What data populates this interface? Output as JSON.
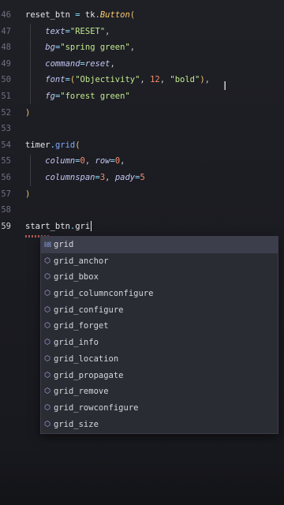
{
  "editor": {
    "lines": [
      {
        "num": "46",
        "parts": [
          {
            "t": "reset_btn",
            "c": "var"
          },
          {
            "t": " = ",
            "c": "op"
          },
          {
            "t": "tk",
            "c": "var"
          },
          {
            "t": ".",
            "c": "op"
          },
          {
            "t": "Button",
            "c": "cls"
          },
          {
            "t": "(",
            "c": "par"
          }
        ]
      },
      {
        "num": "47",
        "parts": [
          {
            "t": "    text",
            "c": "kw"
          },
          {
            "t": "=",
            "c": "op"
          },
          {
            "t": "\"RESET\"",
            "c": "str"
          },
          {
            "t": ",",
            "c": "cm"
          }
        ]
      },
      {
        "num": "48",
        "parts": [
          {
            "t": "    bg",
            "c": "kw"
          },
          {
            "t": "=",
            "c": "op"
          },
          {
            "t": "\"spring green\"",
            "c": "str"
          },
          {
            "t": ",",
            "c": "cm"
          }
        ]
      },
      {
        "num": "49",
        "parts": [
          {
            "t": "    command",
            "c": "kw"
          },
          {
            "t": "=",
            "c": "op"
          },
          {
            "t": "reset",
            "c": "kw"
          },
          {
            "t": ",",
            "c": "cm"
          }
        ]
      },
      {
        "num": "50",
        "parts": [
          {
            "t": "    font",
            "c": "kw"
          },
          {
            "t": "=",
            "c": "op"
          },
          {
            "t": "(",
            "c": "par"
          },
          {
            "t": "\"Objectivity\"",
            "c": "str"
          },
          {
            "t": ", ",
            "c": "cm"
          },
          {
            "t": "12",
            "c": "num"
          },
          {
            "t": ", ",
            "c": "cm"
          },
          {
            "t": "\"bold\"",
            "c": "str"
          },
          {
            "t": ")",
            "c": "par"
          },
          {
            "t": ",",
            "c": "cm"
          }
        ]
      },
      {
        "num": "51",
        "parts": [
          {
            "t": "    fg",
            "c": "kw"
          },
          {
            "t": "=",
            "c": "op"
          },
          {
            "t": "\"forest green\"",
            "c": "str"
          }
        ]
      },
      {
        "num": "52",
        "parts": [
          {
            "t": ")",
            "c": "par"
          }
        ]
      },
      {
        "num": "53",
        "parts": []
      },
      {
        "num": "54",
        "parts": [
          {
            "t": "timer",
            "c": "var"
          },
          {
            "t": ".",
            "c": "op"
          },
          {
            "t": "grid",
            "c": "fn"
          },
          {
            "t": "(",
            "c": "par"
          }
        ]
      },
      {
        "num": "55",
        "parts": [
          {
            "t": "    column",
            "c": "kw"
          },
          {
            "t": "=",
            "c": "op"
          },
          {
            "t": "0",
            "c": "num"
          },
          {
            "t": ", ",
            "c": "cm"
          },
          {
            "t": "row",
            "c": "kw"
          },
          {
            "t": "=",
            "c": "op"
          },
          {
            "t": "0",
            "c": "num"
          },
          {
            "t": ",",
            "c": "cm"
          }
        ]
      },
      {
        "num": "56",
        "parts": [
          {
            "t": "    columnspan",
            "c": "kw"
          },
          {
            "t": "=",
            "c": "op"
          },
          {
            "t": "3",
            "c": "num"
          },
          {
            "t": ", ",
            "c": "cm"
          },
          {
            "t": "pady",
            "c": "kw"
          },
          {
            "t": "=",
            "c": "op"
          },
          {
            "t": "5",
            "c": "num"
          }
        ]
      },
      {
        "num": "57",
        "parts": [
          {
            "t": ")",
            "c": "par"
          }
        ]
      },
      {
        "num": "58",
        "parts": []
      },
      {
        "num": "59",
        "active": true,
        "parts": [
          {
            "t": "start_btn",
            "c": "var"
          },
          {
            "t": ".",
            "c": "op"
          },
          {
            "t": "gri",
            "c": "var"
          }
        ]
      }
    ]
  },
  "suggestions": [
    {
      "label": "grid",
      "icon": "variable-icon",
      "glyph": "[@]",
      "selected": true
    },
    {
      "label": "grid_anchor",
      "icon": "method-icon",
      "glyph": "⬡"
    },
    {
      "label": "grid_bbox",
      "icon": "method-icon",
      "glyph": "⬡"
    },
    {
      "label": "grid_columnconfigure",
      "icon": "method-icon",
      "glyph": "⬡"
    },
    {
      "label": "grid_configure",
      "icon": "method-icon",
      "glyph": "⬡"
    },
    {
      "label": "grid_forget",
      "icon": "method-icon",
      "glyph": "⬡"
    },
    {
      "label": "grid_info",
      "icon": "method-icon",
      "glyph": "⬡"
    },
    {
      "label": "grid_location",
      "icon": "method-icon",
      "glyph": "⬡"
    },
    {
      "label": "grid_propagate",
      "icon": "method-icon",
      "glyph": "⬡"
    },
    {
      "label": "grid_remove",
      "icon": "method-icon",
      "glyph": "⬡"
    },
    {
      "label": "grid_rowconfigure",
      "icon": "method-icon",
      "glyph": "⬡"
    },
    {
      "label": "grid_size",
      "icon": "method-icon",
      "glyph": "⬡"
    }
  ]
}
